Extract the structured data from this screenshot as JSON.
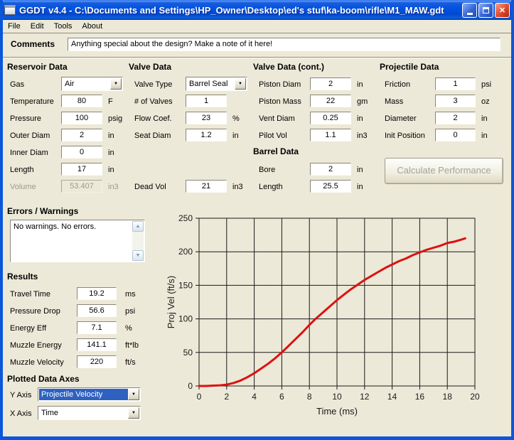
{
  "window": {
    "title": "GGDT v4.4 - C:\\Documents and Settings\\HP_Owner\\Desktop\\ed's stuf\\ka-boom\\rifle\\M1_MAW.gdt"
  },
  "menu": {
    "items": [
      "File",
      "Edit",
      "Tools",
      "About"
    ]
  },
  "comments": {
    "label": "Comments",
    "value": "Anything special about the design?  Make a note of it here!"
  },
  "sections": {
    "reservoir": {
      "title": "Reservoir Data",
      "rows": [
        {
          "label": "Gas",
          "value": "Air",
          "type": "combo"
        },
        {
          "label": "Temperature",
          "value": "80",
          "unit": "F"
        },
        {
          "label": "Pressure",
          "value": "100",
          "unit": "psig"
        },
        {
          "label": "Outer Diam",
          "value": "2",
          "unit": "in"
        },
        {
          "label": "Inner Diam",
          "value": "0",
          "unit": "in"
        },
        {
          "label": "Length",
          "value": "17",
          "unit": "in"
        },
        {
          "label": "Volume",
          "value": "53.407",
          "unit": "in3",
          "disabled": true
        }
      ]
    },
    "valve": {
      "title": "Valve Data",
      "rows": [
        {
          "label": "Valve Type",
          "value": "Barrel Seal",
          "type": "combo"
        },
        {
          "label": "# of Valves",
          "value": "1"
        },
        {
          "label": "Flow Coef.",
          "value": "23",
          "unit": "%"
        },
        {
          "label": "Seat Diam",
          "value": "1.2",
          "unit": "in"
        },
        {
          "label": "Dead Vol",
          "value": "21",
          "unit": "in3",
          "row": 7
        }
      ]
    },
    "valve2": {
      "title": "Valve Data (cont.)",
      "rows": [
        {
          "label": "Piston Diam",
          "value": "2",
          "unit": "in"
        },
        {
          "label": "Piston Mass",
          "value": "22",
          "unit": "gm"
        },
        {
          "label": "Vent Diam",
          "value": "0.25",
          "unit": "in"
        },
        {
          "label": "Pilot Vol",
          "value": "1.1",
          "unit": "in3"
        }
      ]
    },
    "barrel": {
      "title": "Barrel Data",
      "rows": [
        {
          "label": "Bore",
          "value": "2",
          "unit": "in",
          "row": 6
        },
        {
          "label": "Length",
          "value": "25.5",
          "unit": "in",
          "row": 7
        }
      ]
    },
    "projectile": {
      "title": "Projectile Data",
      "button": "Calculate Performance",
      "rows": [
        {
          "label": "Friction",
          "value": "1",
          "unit": "psi"
        },
        {
          "label": "Mass",
          "value": "3",
          "unit": "oz"
        },
        {
          "label": "Diameter",
          "value": "2",
          "unit": "in"
        },
        {
          "label": "Init Position",
          "value": "0",
          "unit": "in"
        }
      ]
    }
  },
  "errors": {
    "title": "Errors / Warnings",
    "text": "No warnings.  No errors."
  },
  "results": {
    "title": "Results",
    "rows": [
      {
        "label": "Travel Time",
        "value": "19.2",
        "unit": "ms"
      },
      {
        "label": "Pressure Drop",
        "value": "56.6",
        "unit": "psi"
      },
      {
        "label": "Energy Eff",
        "value": "7.1",
        "unit": "%"
      },
      {
        "label": "Muzzle Energy",
        "value": "141.1",
        "unit": "ft*lb"
      },
      {
        "label": "Muzzle Velocity",
        "value": "220",
        "unit": "ft/s"
      }
    ]
  },
  "axes": {
    "title": "Plotted Data Axes",
    "y_label": "Y Axis",
    "y_value": "Projectile Velocity",
    "x_label": "X Axis",
    "x_value": "Time"
  },
  "chart_data": {
    "type": "line",
    "xlabel": "Time (ms)",
    "ylabel": "Proj Vel (ft/s)",
    "xlim": [
      0,
      20
    ],
    "ylim": [
      0,
      250
    ],
    "xticks": [
      0,
      2,
      4,
      6,
      8,
      10,
      12,
      14,
      16,
      18,
      20
    ],
    "yticks": [
      0,
      50,
      100,
      150,
      200,
      250
    ],
    "grid": true,
    "legend": "none",
    "series": [
      {
        "name": "Projectile Velocity",
        "color": "#dd1111",
        "x": [
          0,
          0.5,
          1,
          1.5,
          2,
          2.5,
          3,
          3.5,
          4,
          4.5,
          5,
          5.5,
          6,
          6.5,
          7,
          7.5,
          8,
          8.5,
          9,
          9.5,
          10,
          10.5,
          11,
          11.5,
          12,
          12.5,
          13,
          13.5,
          14,
          14.5,
          15,
          15.5,
          16,
          16.5,
          17,
          17.5,
          18,
          18.5,
          19,
          19.3
        ],
        "y": [
          0,
          0,
          0.5,
          1,
          2,
          4.5,
          8,
          13,
          19,
          26,
          33,
          41,
          50,
          60,
          70,
          80,
          91,
          101,
          110,
          119,
          128,
          136,
          144,
          151,
          158,
          164,
          170,
          176,
          181,
          186,
          190,
          195,
          199,
          203,
          206,
          209,
          213,
          215,
          218,
          220
        ]
      }
    ]
  }
}
